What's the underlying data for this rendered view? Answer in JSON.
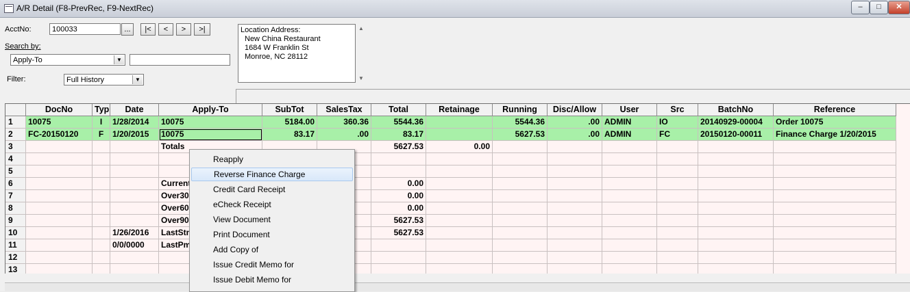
{
  "window": {
    "title": "A/R Detail  (F8-PrevRec, F9-NextRec)"
  },
  "form": {
    "acctno_label": "AcctNo:",
    "acctno_value": "100033",
    "lookup_label": "...",
    "nav": [
      "|<",
      "<",
      ">",
      ">|"
    ],
    "searchby_label": "Search by:",
    "searchby_value": "Apply-To",
    "search_text": "",
    "filter_label": "Filter:",
    "filter_value": "Full History"
  },
  "address": {
    "heading": "Location Address:",
    "lines": [
      "New China Restaurant",
      "1684 W Franklin St",
      "Monroe, NC 28112"
    ]
  },
  "grid": {
    "columns": [
      "",
      "DocNo",
      "Typ",
      "Date",
      "Apply-To",
      "SubTot",
      "SalesTax",
      "Total",
      "Retainage",
      "Running",
      "Disc/Allow",
      "User",
      "Src",
      "BatchNo",
      "Reference"
    ],
    "rows": [
      [
        "1",
        "10075",
        "I",
        "1/28/2014",
        "10075",
        "5184.00",
        "360.36",
        "5544.36",
        "",
        "5544.36",
        ".00",
        "ADMIN",
        "IO",
        "20140929-00004",
        "Order 10075"
      ],
      [
        "2",
        "FC-20150120",
        "F",
        "1/20/2015",
        "10075",
        "83.17",
        ".00",
        "83.17",
        "",
        "5627.53",
        ".00",
        "ADMIN",
        "FC",
        "20150120-00011",
        "Finance Charge 1/20/2015"
      ],
      [
        "3",
        "",
        "",
        "",
        "Totals",
        "",
        "",
        "5627.53",
        "0.00",
        "",
        "",
        "",
        "",
        "",
        ""
      ],
      [
        "4",
        "",
        "",
        "",
        "",
        "",
        "",
        "",
        "",
        "",
        "",
        "",
        "",
        "",
        ""
      ],
      [
        "5",
        "",
        "",
        "",
        "",
        "",
        "",
        "",
        "",
        "",
        "",
        "",
        "",
        "",
        ""
      ],
      [
        "6",
        "",
        "",
        "",
        "Current",
        "",
        "",
        "0.00",
        "",
        "",
        "",
        "",
        "",
        "",
        ""
      ],
      [
        "7",
        "",
        "",
        "",
        "Over30",
        "",
        "",
        "0.00",
        "",
        "",
        "",
        "",
        "",
        "",
        ""
      ],
      [
        "8",
        "",
        "",
        "",
        "Over60",
        "",
        "",
        "0.00",
        "",
        "",
        "",
        "",
        "",
        "",
        ""
      ],
      [
        "9",
        "",
        "",
        "",
        "Over90",
        "",
        "",
        "5627.53",
        "",
        "",
        "",
        "",
        "",
        "",
        ""
      ],
      [
        "10",
        "",
        "",
        "1/26/2016",
        "LastStmt",
        "",
        "",
        "5627.53",
        "",
        "",
        "",
        "",
        "",
        "",
        ""
      ],
      [
        "11",
        "",
        "",
        "0/0/0000",
        "LastPmt",
        "",
        "",
        "",
        "",
        "",
        "",
        "",
        "",
        "",
        ""
      ],
      [
        "12",
        "",
        "",
        "",
        "",
        "",
        "",
        "",
        "",
        "",
        "",
        "",
        "",
        "",
        ""
      ],
      [
        "13",
        "",
        "",
        "",
        "",
        "",
        "",
        "",
        "",
        "",
        "",
        "",
        "",
        "",
        ""
      ]
    ]
  },
  "context_menu": {
    "items": [
      "Reapply",
      "Reverse Finance Charge",
      "Credit Card Receipt",
      "eCheck Receipt",
      "View Document",
      "Print Document",
      "Add Copy of",
      "Issue Credit Memo for",
      "Issue Debit Memo for"
    ],
    "highlighted_index": 1
  },
  "colors": {
    "row_highlight": "#a8f0a8",
    "grid_bg": "#fff4f4"
  }
}
